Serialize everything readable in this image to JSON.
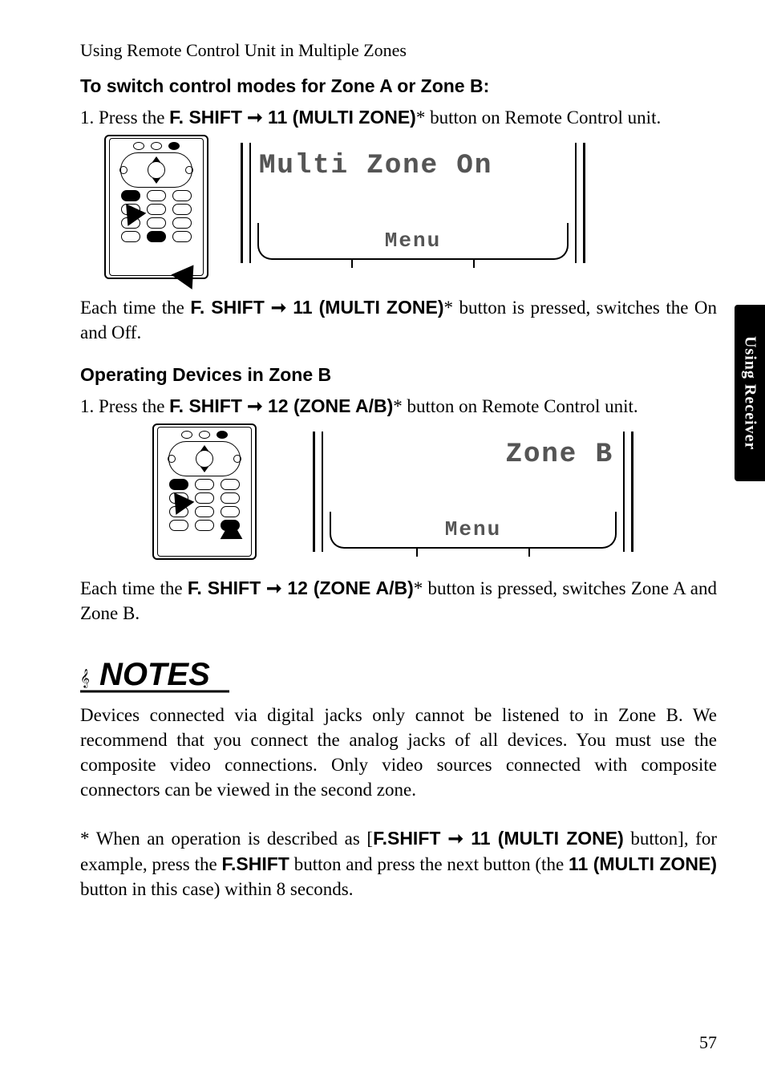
{
  "header": {
    "running_head": "Using Remote Control Unit in Multiple Zones"
  },
  "section1": {
    "heading": "To switch control modes for Zone A or Zone B:",
    "step_prefix": "1.   Press the ",
    "fshift": "F. SHIFT",
    "arrow": " ➞ ",
    "btn": "11 (MULTI ZONE)",
    "star_suffix": "* button on Remote Control unit.",
    "lcd_line": "Multi Zone On",
    "lcd_menu": "Menu",
    "after_prefix": "Each time the ",
    "after_suffix": "* button is pressed, switches the On and Off."
  },
  "section2": {
    "heading": "Operating Devices in Zone B",
    "step_prefix": "1.   Press the ",
    "fshift": "F. SHIFT",
    "arrow": " ➞ ",
    "btn": "12 (ZONE A/B)",
    "star_suffix": "* button on Remote Control unit.",
    "lcd_line": "Zone B",
    "lcd_menu": "Menu",
    "after_prefix": "Each time the ",
    "after_suffix": "* button is pressed, switches Zone A and Zone B."
  },
  "notes": {
    "label": "NOTES",
    "body": "Devices connected via digital jacks only cannot be listened to in Zone B. We recommend that you connect the analog jacks of all devices. You must use the composite video connections. Only video sources connected with composite connectors can be viewed in the second zone."
  },
  "footnote": {
    "pre": "* When an operation is described as [",
    "fshift1": "F.SHIFT",
    "arrow": " ➞ ",
    "btn1": "11 (MULTI ZONE)",
    "mid1": " button], for example, press the ",
    "fshift2": "F.SHIFT",
    "mid2": " button and press the next button (the ",
    "btn2": "11 (MULTI ZONE)",
    "post": " button in this case) within 8 seconds."
  },
  "side_tab": "Using Receiver",
  "page_number": "57"
}
